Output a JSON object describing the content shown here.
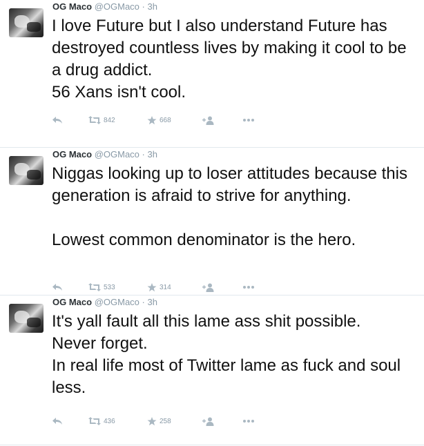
{
  "colors": {
    "text": "#111111",
    "meta": "#8899a6",
    "divider": "#e1e8ed",
    "icon": "#aab8c2"
  },
  "tweets": [
    {
      "fullname": "OG Maco",
      "username": "@OGMaco",
      "separator": "·",
      "time": "3h",
      "lines": [
        "I love Future but I also understand Future has destroyed countless lives by making it cool to be a drug addict.",
        "56 Xans isn't cool."
      ],
      "retweets": "842",
      "favorites": "668"
    },
    {
      "fullname": "OG Maco",
      "username": "@OGMaco",
      "separator": "·",
      "time": "3h",
      "lines": [
        "Niggas looking up to loser attitudes because this generation is afraid to strive for anything.",
        "",
        "Lowest common denominator is the hero."
      ],
      "retweets": "533",
      "favorites": "314"
    },
    {
      "fullname": "OG Maco",
      "username": "@OGMaco",
      "separator": "·",
      "time": "3h",
      "lines": [
        "It's yall fault all this lame ass shit possible.",
        "Never forget.",
        "In real life most of Twitter lame as fuck and soul less."
      ],
      "retweets": "436",
      "favorites": "258"
    }
  ]
}
